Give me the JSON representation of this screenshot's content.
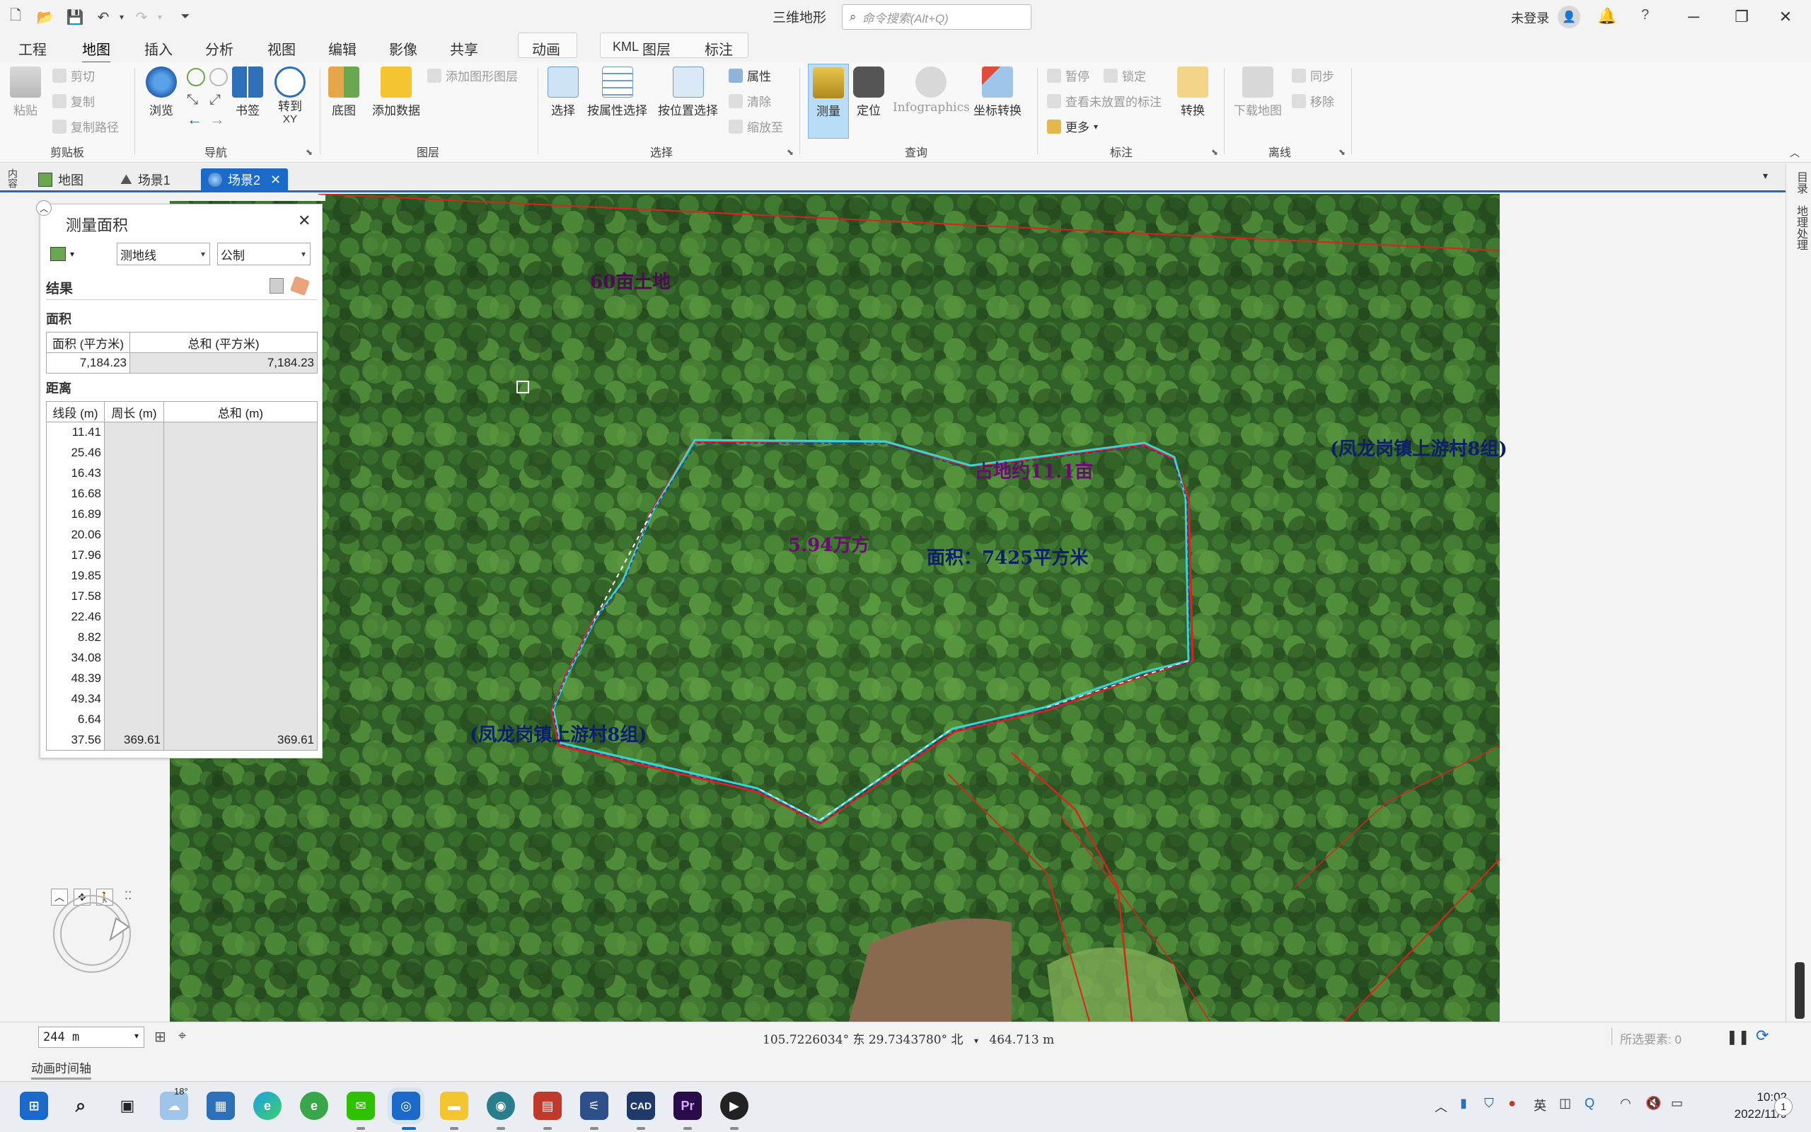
{
  "titlebar": {
    "app_title": "三维地形",
    "search_placeholder": "命令搜索(Alt+Q)",
    "login_text": "未登录",
    "help": "?"
  },
  "ribbon_tabs": [
    "工程",
    "地图",
    "插入",
    "分析",
    "视图",
    "编辑",
    "影像",
    "共享",
    "动画",
    "KML",
    "图层",
    "标注"
  ],
  "ribbon": {
    "clipboard": {
      "paste": "粘贴",
      "cut": "剪切",
      "copy": "复制",
      "copy_path": "复制路径",
      "group": "剪贴板"
    },
    "navigate": {
      "explore": "浏览",
      "bookmarks": "书签",
      "goto_xy_line1": "转到",
      "goto_xy_line2": "XY",
      "group": "导航"
    },
    "layer": {
      "basemap": "底图",
      "add_data": "添加数据",
      "add_graphics_layer": "添加图形图层",
      "group": "图层"
    },
    "selection": {
      "select": "选择",
      "by_attribute": "按属性选择",
      "by_location": "按位置选择",
      "attributes": "属性",
      "clear": "清除",
      "zoom_to": "缩放至",
      "group": "选择"
    },
    "inquiry": {
      "measure": "测量",
      "locate": "定位",
      "infographics": "Infographics",
      "coord_convert": "坐标转换",
      "group": "查询"
    },
    "labeling": {
      "pause": "暂停",
      "lock": "锁定",
      "view_unplaced": "查看未放置的标注",
      "more": "更多",
      "convert": "转换",
      "group": "标注"
    },
    "offline": {
      "download_map": "下载地图",
      "sync": "同步",
      "remove": "移除",
      "group": "离线"
    }
  },
  "doc_tabs": [
    {
      "label": "地图"
    },
    {
      "label": "场景1"
    },
    {
      "label": "场景2"
    }
  ],
  "measure_panel": {
    "title": "测量面积",
    "mode": "测地线",
    "units": "公制",
    "results_label": "结果",
    "area_label": "面积",
    "area_col1": "面积 (平方米)",
    "area_col2": "总和 (平方米)",
    "area_value": "7,184.23",
    "area_total": "7,184.23",
    "distance_label": "距离",
    "dist_col1": "线段 (m)",
    "dist_col2": "周长 (m)",
    "dist_col3": "总和 (m)",
    "segments": [
      "11.41",
      "25.46",
      "16.43",
      "16.68",
      "16.89",
      "20.06",
      "17.96",
      "19.85",
      "17.58",
      "22.46",
      "8.82",
      "34.08",
      "48.39",
      "49.34",
      "6.64",
      "37.56"
    ],
    "perimeter": "369.61",
    "total": "369.61"
  },
  "map_labels": {
    "top_left": "60亩土地",
    "top_center": "占地约11.1亩",
    "volume": "5.94万方",
    "area": "面积：7425平方米",
    "right_owner": "(凤龙岗镇上游村8组)",
    "left_owner": "(凤龙岗镇上游村8组)"
  },
  "statusbar": {
    "scale": "244 m",
    "coordinates": "105.7226034° 东  29.7343780° 北",
    "elevation": "464.713 m",
    "selected_features": "所选要素: 0"
  },
  "animation_timeline": "动画时间轴",
  "right_dock": {
    "catalog": "目录",
    "geoprocessing": "地理处理"
  },
  "left_dock": {
    "contents": "内容"
  },
  "taskbar": {
    "weather": "18°",
    "time": "10:02",
    "date": "2022/11/9",
    "notification_count": "1"
  },
  "colors": {
    "accent": "#1b6ac9",
    "boundary_cyan": "#35d7d0",
    "boundary_red": "#d9231f",
    "label_purple": "#6b0a72",
    "label_navy": "#0b1f6a"
  }
}
